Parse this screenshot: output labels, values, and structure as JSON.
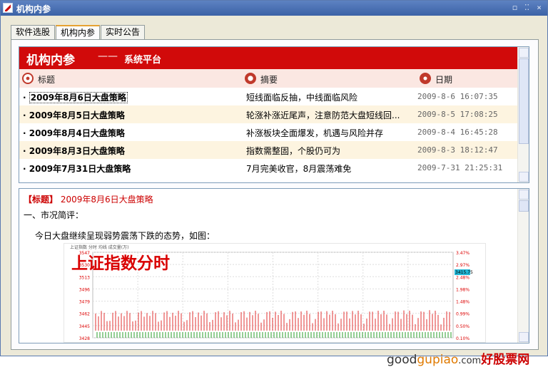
{
  "window": {
    "title": "机构内参",
    "btn_restore": "◻",
    "btn_grip": "⁚⁚",
    "btn_close": "×"
  },
  "tabs": [
    {
      "label": "软件选股",
      "active": false
    },
    {
      "label": "机构内参",
      "active": true
    },
    {
      "label": "实时公告",
      "active": false
    }
  ],
  "banner": {
    "title": "机构内参",
    "separator": "——",
    "subtitle": "系统平台"
  },
  "list": {
    "header": {
      "title": "标题",
      "summary": "摘要",
      "date": "日期"
    },
    "rows": [
      {
        "title": "2009年8月6日大盘策略",
        "summary": "短线面临反抽，中线面临风险",
        "date": "2009-8-6 16:07:35"
      },
      {
        "title": "2009年8月5日大盘策略",
        "summary": "轮涨补涨近尾声，注意防范大盘短线回...",
        "date": "2009-8-5 17:08:25"
      },
      {
        "title": "2009年8月4日大盘策略",
        "summary": "补涨板块全面爆发，机遇与风险并存",
        "date": "2009-8-4 16:45:28"
      },
      {
        "title": "2009年8月3日大盘策略",
        "summary": "指数需整固，个股仍可为",
        "date": "2009-8-3 18:12:47"
      },
      {
        "title": "2009年7月31日大盘策略",
        "summary": "7月完美收官，8月震荡难免",
        "date": "2009-7-31 21:25:31"
      }
    ]
  },
  "detail": {
    "title_label": "【标题】",
    "title_value": "2009年8月6日大盘策略",
    "section": "一、市况简评：",
    "paragraph": "今日大盘继续呈现弱势震荡下跌的态势，如图：",
    "chart_caption": "上证指数分时",
    "chart_top": "上证指数  分时  均线  成交量(万)",
    "y_left": [
      "3547",
      "3530",
      "3513",
      "3496",
      "3479",
      "3462",
      "3445",
      "3428"
    ],
    "y_right": [
      "3.47%",
      "2.97%",
      "2.48%",
      "1.98%",
      "1.48%",
      "0.99%",
      "0.50%",
      "0.10%"
    ],
    "price_tag": "3415.75"
  },
  "watermark": {
    "part1": "good",
    "part2": "gupiao",
    "part3": ".com",
    "part4": "好股票网"
  },
  "colors": {
    "banner": "#d10a0a",
    "alt_row": "#fdf4e0",
    "header": "#fbe7e2",
    "accent": "#cc0000"
  }
}
